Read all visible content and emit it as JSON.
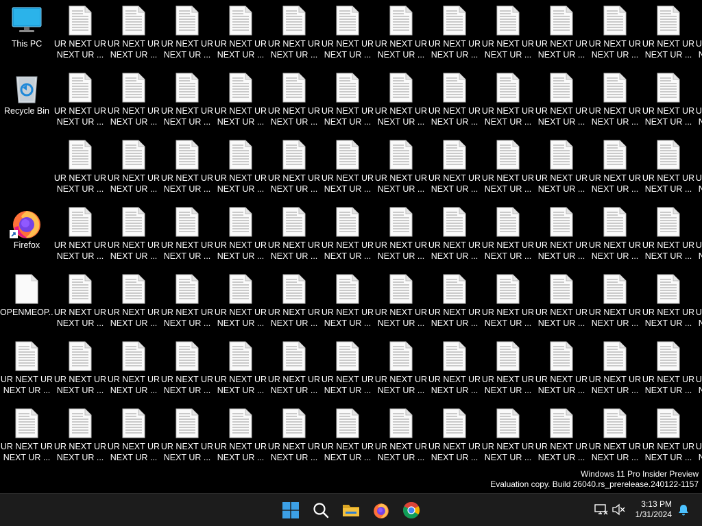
{
  "desktop": {
    "special_icons": [
      {
        "key": "this_pc",
        "label": "This PC",
        "icon": "computer-icon"
      },
      {
        "key": "recycle_bin",
        "label": "Recycle Bin",
        "icon": "recycle-bin-icon"
      },
      {
        "key": "firefox",
        "label": "Firefox",
        "icon": "firefox-icon"
      },
      {
        "key": "openmeop",
        "label": "OPENMEOP...",
        "icon": "blank-file-icon"
      }
    ],
    "file_label": "UR NEXT UR\nNEXT UR ...",
    "file_icon": "text-document-icon"
  },
  "watermark": {
    "line1": "Windows 11 Pro Insider Preview",
    "line2": "Evaluation copy. Build 26040.rs_prerelease.240122-1157"
  },
  "taskbar": {
    "apps": [
      {
        "name": "start-button",
        "icon": "windows-logo-icon"
      },
      {
        "name": "search-button",
        "icon": "search-icon"
      },
      {
        "name": "file-explorer-button",
        "icon": "folder-icon"
      },
      {
        "name": "firefox-taskbar-button",
        "icon": "firefox-icon"
      },
      {
        "name": "chrome-taskbar-button",
        "icon": "chrome-icon"
      }
    ],
    "tray": {
      "network_icon": "network-disconnected-icon",
      "volume_icon": "volume-muted-icon",
      "notification_icon": "bell-icon",
      "time": "3:13 PM",
      "date": "1/31/2024"
    }
  },
  "colors": {
    "background": "#000000",
    "taskbar": "#1c1c1c",
    "windows_blue": "#3ca0e6",
    "folder_yellow": "#f5c13d",
    "notification_blue": "#4cc2ff"
  }
}
